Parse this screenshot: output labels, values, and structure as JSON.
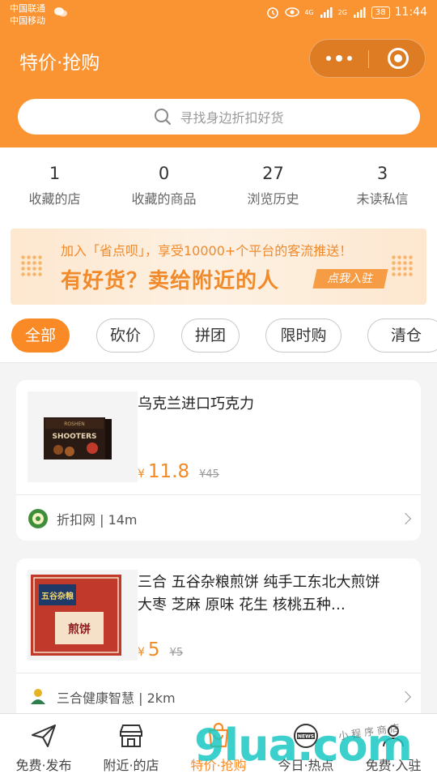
{
  "status_bar": {
    "carrier_1": "中国联通",
    "carrier_2": "中国移动",
    "network_1": "4G",
    "network_2": "2G",
    "battery": "38",
    "time": "11:44"
  },
  "header": {
    "title": "特价·抢购",
    "search_placeholder": "寻找身边折扣好货",
    "accent_color": "#fa9433"
  },
  "stats": [
    {
      "value": "1",
      "label": "收藏的店"
    },
    {
      "value": "0",
      "label": "收藏的商品"
    },
    {
      "value": "27",
      "label": "浏览历史"
    },
    {
      "value": "3",
      "label": "未读私信"
    }
  ],
  "banner": {
    "line1": "加入「省点呗」，享受10000+个平台的客流推送！",
    "line2": "有好货？卖给附近的人",
    "button": "点我入驻"
  },
  "filters": [
    "全部",
    "砍价",
    "拼团",
    "限时购",
    "清仓"
  ],
  "active_filter": "全部",
  "products": [
    {
      "title": "乌克兰进口巧克力",
      "currency": "¥",
      "price": "11.8",
      "original_price": "¥45",
      "shop": "折扣网 | 14m",
      "image_text_1": "SHOOTERS",
      "image_text_2": "ROSHEN"
    },
    {
      "title": "三合 五谷杂粮煎饼 纯手工东北大煎饼 大枣 芝麻 原味 花生 核桃五种…",
      "currency": "¥",
      "price": "5",
      "original_price": "¥5",
      "shop": "三合健康智慧 | 2km",
      "image_text_1": "五谷杂粮",
      "image_text_2": "煎饼"
    }
  ],
  "tabbar": [
    {
      "label": "免费·发布",
      "icon": "paper-plane-icon"
    },
    {
      "label": "附近·的店",
      "icon": "store-icon"
    },
    {
      "label": "特价·抢购",
      "icon": "shopping-bag-icon",
      "active": true
    },
    {
      "label": "今日·热点",
      "icon": "news-icon"
    },
    {
      "label": "免费·入驻",
      "icon": "user-icon"
    }
  ],
  "watermark": {
    "text": "9lua.com",
    "handwriting": "小程序商店"
  }
}
